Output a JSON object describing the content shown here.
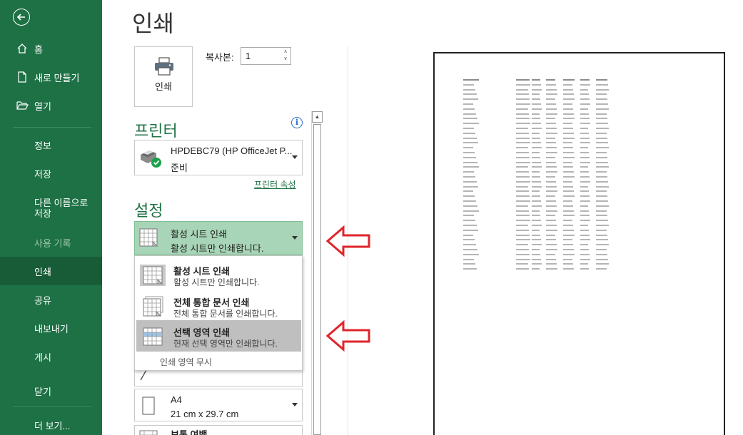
{
  "sidebar": {
    "items": [
      {
        "label": "홈",
        "icon": "home-icon"
      },
      {
        "label": "새로 만들기",
        "icon": "new-document-icon"
      },
      {
        "label": "열기",
        "icon": "open-folder-icon"
      },
      {
        "label": "정보"
      },
      {
        "label": "저장"
      },
      {
        "label": "다른 이름으로 저장"
      },
      {
        "label": "사용 기록"
      },
      {
        "label": "인쇄"
      },
      {
        "label": "공유"
      },
      {
        "label": "내보내기"
      },
      {
        "label": "게시"
      },
      {
        "label": "닫기"
      },
      {
        "label": "더 보기..."
      }
    ]
  },
  "main": {
    "title": "인쇄",
    "print_button": "인쇄",
    "copies": {
      "label": "복사본:",
      "value": "1"
    },
    "printer_section": "프린터",
    "printer": {
      "name": "HPDEBC79 (HP OfficeJet P...",
      "status": "준비"
    },
    "printer_properties": "프린터 속성",
    "settings_section": "설정",
    "selected_option": {
      "title": "활성 시트 인쇄",
      "desc": "활성 시트만 인쇄합니다."
    },
    "menu": {
      "items": [
        {
          "title": "활성 시트 인쇄",
          "desc": "활성 시트만 인쇄합니다."
        },
        {
          "title": "전체 통합 문서 인쇄",
          "desc": "전체 통합 문서를 인쇄합니다."
        },
        {
          "title": "선택 영역 인쇄",
          "desc": "현재 선택 영역만 인쇄합니다."
        }
      ],
      "ignore_print_area": "인쇄 영역 무시"
    },
    "paper": {
      "size": "A4",
      "dimensions": "21 cm x 29.7 cm"
    },
    "margins": {
      "title": "보통 여백"
    }
  },
  "colors": {
    "accent": "#1e7145",
    "sidebar_active": "#185c37",
    "selection": "#a8d5b7",
    "annotation_arrow": "#e0242b"
  }
}
